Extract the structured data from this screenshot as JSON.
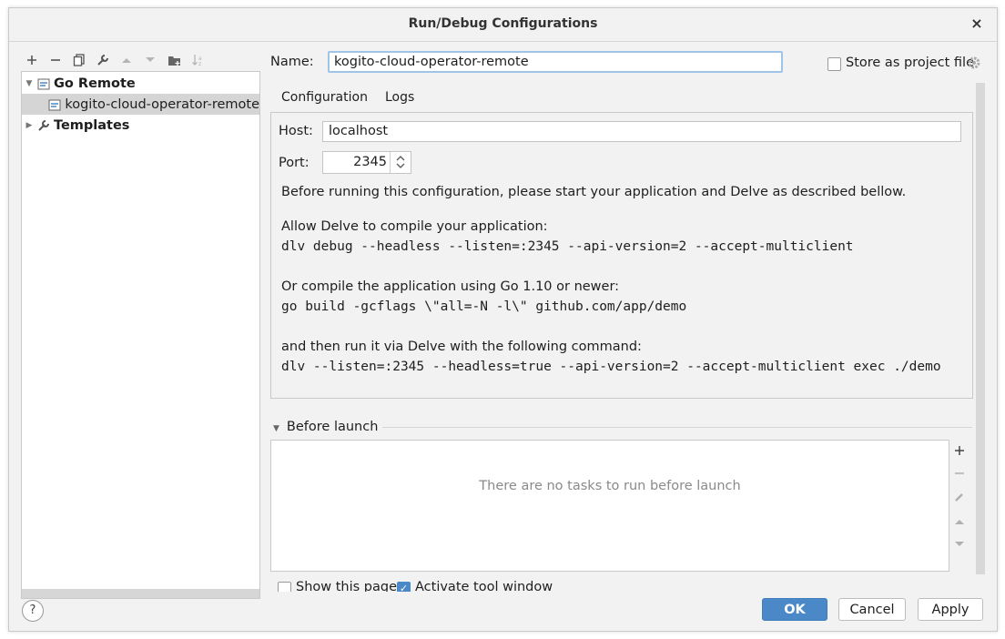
{
  "window": {
    "title": "Run/Debug Configurations",
    "close_glyph": "×"
  },
  "toolbar": {
    "icons": [
      "add-icon",
      "remove-icon",
      "copy-icon",
      "wrench-icon",
      "move-up-icon",
      "move-down-icon",
      "folder-icon",
      "sort-icon"
    ]
  },
  "tree": {
    "go_remote": "Go Remote",
    "config_item": "kogito-cloud-operator-remote",
    "templates": "Templates"
  },
  "form": {
    "name_label": "Name:",
    "name_value": "kogito-cloud-operator-remote",
    "store_label": "Store as project file",
    "tabs": [
      "Configuration",
      "Logs"
    ],
    "host_label": "Host:",
    "host_value": "localhost",
    "port_label": "Port:",
    "port_value": "2345",
    "intro": "Before running this configuration, please start your application and Delve as described bellow.",
    "allow_text": "Allow Delve to compile your application:",
    "cmd1": "dlv debug --headless --listen=:2345 --api-version=2 --accept-multiclient",
    "or_text": "Or compile the application using Go 1.10 or newer:",
    "cmd2": "go build -gcflags \\\"all=-N -l\\\" github.com/app/demo",
    "then_text": "and then run it via Delve with the following command:",
    "cmd3": "dlv --listen=:2345 --headless=true --api-version=2 --accept-multiclient exec ./demo"
  },
  "before_launch": {
    "label": "Before launch",
    "empty_text": "There are no tasks to run before launch",
    "tools": [
      "plus-icon",
      "minus-icon",
      "pencil-icon",
      "arrow-up-icon",
      "arrow-down-icon"
    ]
  },
  "bottom": {
    "show_page": "Show this page",
    "activate_tool": "Activate tool window",
    "help": "?"
  },
  "buttons": {
    "ok": "OK",
    "cancel": "Cancel",
    "apply": "Apply"
  }
}
